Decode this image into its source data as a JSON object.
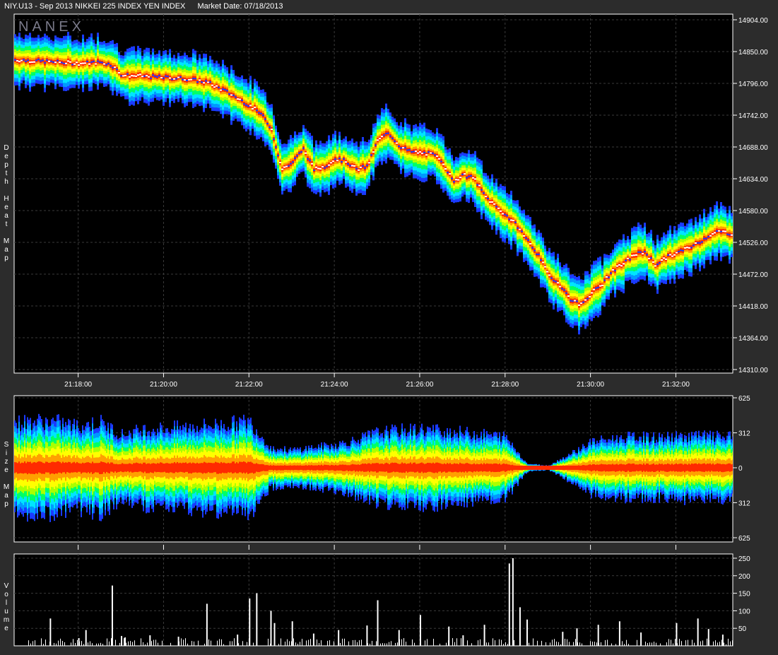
{
  "header": {
    "instrument": "NIY.U13 - Sep 2013 NIKKEI 225 INDEX YEN INDEX",
    "market_date": "Market Date: 07/18/2013"
  },
  "watermark": "NANEX",
  "colors": {
    "background": "#2c2c2c",
    "plot_background": "#000000",
    "grid": "#3a3a3a",
    "axis": "#ffffff",
    "heat_scale": [
      "#1a3aff",
      "#0099ff",
      "#00e5ff",
      "#00ff66",
      "#aaff00",
      "#ffff00",
      "#ffa000",
      "#ff2a00"
    ]
  },
  "chart_data": [
    {
      "type": "heatmap",
      "label_text": "Depth Heat Map",
      "title": "",
      "y_ticks": [
        "14904.00",
        "14850.00",
        "14796.00",
        "14742.00",
        "14688.00",
        "14634.00",
        "14580.00",
        "14526.00",
        "14472.00",
        "14418.00",
        "14364.00",
        "14310.00"
      ],
      "ylim": [
        14310,
        14904
      ],
      "x_ticks": [
        "21:18:00",
        "21:20:00",
        "21:22:00",
        "21:24:00",
        "21:26:00",
        "21:28:00",
        "21:30:00",
        "21:32:00"
      ],
      "xlim": [
        "21:16:30",
        "21:33:20"
      ],
      "grid": true,
      "price_path": {
        "times": [
          "21:16:30",
          "21:17:00",
          "21:17:30",
          "21:18:00",
          "21:18:30",
          "21:18:45",
          "21:19:00",
          "21:19:30",
          "21:20:00",
          "21:20:30",
          "21:21:00",
          "21:21:30",
          "21:22:00",
          "21:22:15",
          "21:22:30",
          "21:22:45",
          "21:23:00",
          "21:23:15",
          "21:23:30",
          "21:23:45",
          "21:24:00",
          "21:24:15",
          "21:24:30",
          "21:24:45",
          "21:25:00",
          "21:25:15",
          "21:25:30",
          "21:25:45",
          "21:26:00",
          "21:26:15",
          "21:26:30",
          "21:26:45",
          "21:27:00",
          "21:27:15",
          "21:27:30",
          "21:27:45",
          "21:28:00",
          "21:28:15",
          "21:28:30",
          "21:28:45",
          "21:29:00",
          "21:29:15",
          "21:29:30",
          "21:29:45",
          "21:30:00",
          "21:30:15",
          "21:30:30",
          "21:30:45",
          "21:31:00",
          "21:31:15",
          "21:31:30",
          "21:31:45",
          "21:32:00",
          "21:32:15",
          "21:32:30",
          "21:32:45",
          "21:33:00",
          "21:33:20"
        ],
        "mid_prices": [
          14836,
          14834,
          14832,
          14830,
          14832,
          14828,
          14810,
          14808,
          14806,
          14804,
          14798,
          14780,
          14758,
          14745,
          14720,
          14650,
          14662,
          14685,
          14650,
          14655,
          14668,
          14664,
          14650,
          14655,
          14700,
          14712,
          14690,
          14680,
          14678,
          14676,
          14665,
          14630,
          14640,
          14635,
          14605,
          14588,
          14572,
          14555,
          14530,
          14505,
          14470,
          14455,
          14430,
          14420,
          14440,
          14455,
          14478,
          14490,
          14505,
          14510,
          14488,
          14500,
          14508,
          14516,
          14525,
          14538,
          14545,
          14540
        ]
      },
      "heat_legend": "blue = low depth, red = high depth"
    },
    {
      "type": "heatmap",
      "label_text": "Size Map",
      "title": "",
      "y_ticks": [
        "625",
        "312",
        "0",
        "312",
        "625"
      ],
      "ylim": [
        -625,
        625
      ],
      "x_ticks": [
        "21:18:00",
        "21:20:00",
        "21:22:00",
        "21:24:00",
        "21:26:00",
        "21:28:00",
        "21:30:00",
        "21:32:00"
      ],
      "xlim": [
        "21:16:30",
        "21:33:20"
      ],
      "grid": true,
      "spread_envelope": {
        "times": [
          "21:16:30",
          "21:17:00",
          "21:17:30",
          "21:18:00",
          "21:18:30",
          "21:19:00",
          "21:19:30",
          "21:20:00",
          "21:20:30",
          "21:21:00",
          "21:21:30",
          "21:22:00",
          "21:22:30",
          "21:23:00",
          "21:23:30",
          "21:24:00",
          "21:24:30",
          "21:25:00",
          "21:25:30",
          "21:26:00",
          "21:26:30",
          "21:27:00",
          "21:27:30",
          "21:28:00",
          "21:28:30",
          "21:29:00",
          "21:29:30",
          "21:30:00",
          "21:30:30",
          "21:31:00",
          "21:31:30",
          "21:32:00",
          "21:32:30",
          "21:33:00",
          "21:33:20"
        ],
        "size": [
          430,
          450,
          440,
          400,
          440,
          320,
          370,
          380,
          390,
          410,
          420,
          450,
          190,
          170,
          200,
          220,
          270,
          340,
          360,
          370,
          360,
          340,
          320,
          300,
          40,
          20,
          130,
          250,
          280,
          300,
          290,
          300,
          310,
          300,
          300
        ]
      }
    },
    {
      "type": "bar",
      "label_text": "Volume",
      "title": "",
      "y_ticks": [
        "250",
        "200",
        "150",
        "100",
        "50"
      ],
      "ylim": [
        0,
        250
      ],
      "x_ticks": [
        "21:18:00",
        "21:20:00",
        "21:22:00",
        "21:24:00",
        "21:26:00",
        "21:28:00",
        "21:30:00",
        "21:32:00"
      ],
      "xlim": [
        "21:16:30",
        "21:33:20"
      ],
      "grid": true,
      "bars": {
        "times": [
          "21:17:20",
          "21:18:00",
          "21:18:10",
          "21:18:47",
          "21:19:00",
          "21:19:05",
          "21:19:40",
          "21:20:20",
          "21:21:00",
          "21:22:00",
          "21:21:43",
          "21:22:10",
          "21:22:30",
          "21:22:35",
          "21:23:00",
          "21:23:30",
          "21:24:05",
          "21:24:45",
          "21:25:00",
          "21:25:30",
          "21:26:00",
          "21:26:40",
          "21:27:00",
          "21:27:30",
          "21:28:05",
          "21:28:10",
          "21:28:20",
          "21:28:30",
          "21:29:20",
          "21:29:40",
          "21:30:10",
          "21:30:40",
          "21:31:10",
          "21:32:00",
          "21:32:30",
          "21:32:45",
          "21:33:05"
        ],
        "volumes": [
          78,
          22,
          45,
          172,
          28,
          24,
          30,
          26,
          120,
          135,
          32,
          150,
          100,
          65,
          70,
          35,
          45,
          58,
          130,
          45,
          88,
          55,
          30,
          60,
          235,
          250,
          110,
          75,
          40,
          50,
          60,
          70,
          38,
          65,
          78,
          48,
          32
        ]
      }
    }
  ]
}
